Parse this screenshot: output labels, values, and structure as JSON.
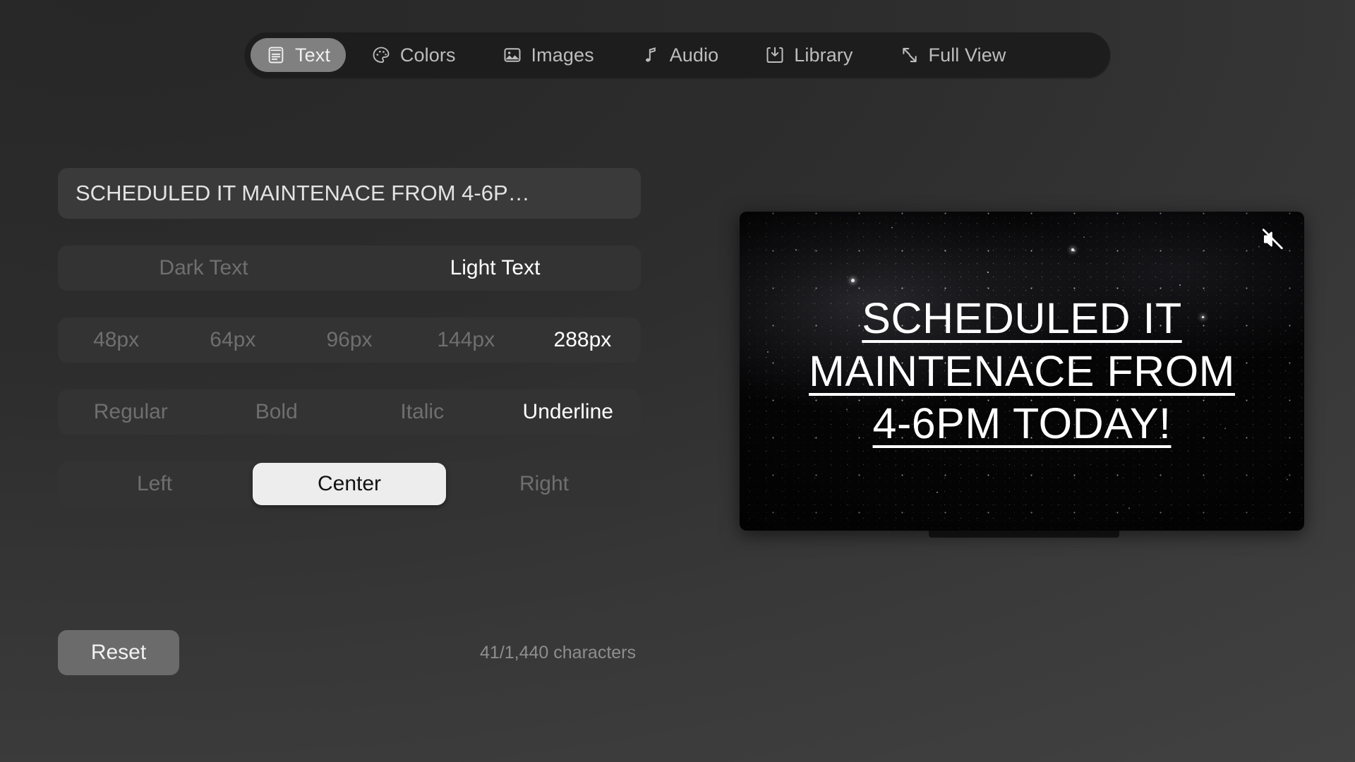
{
  "nav": {
    "items": [
      {
        "label": "Text",
        "icon": "text-document-icon",
        "active": true
      },
      {
        "label": "Colors",
        "icon": "palette-icon",
        "active": false
      },
      {
        "label": "Images",
        "icon": "image-icon",
        "active": false
      },
      {
        "label": "Audio",
        "icon": "music-note-icon",
        "active": false
      },
      {
        "label": "Library",
        "icon": "download-tray-icon",
        "active": false
      },
      {
        "label": "Full View",
        "icon": "expand-arrows-icon",
        "active": false
      }
    ]
  },
  "editor": {
    "text_input": {
      "value": "SCHEDULED IT MAINTENACE FROM 4-6P…",
      "placeholder": "Enter your message"
    },
    "rows": {
      "theme": {
        "name": "text-theme",
        "options": [
          "Dark Text",
          "Light Text"
        ],
        "selected": "Light Text"
      },
      "size": {
        "name": "font-size",
        "options": [
          "48px",
          "64px",
          "96px",
          "144px",
          "288px"
        ],
        "selected": "288px"
      },
      "style": {
        "name": "font-style",
        "options": [
          "Regular",
          "Bold",
          "Italic",
          "Underline"
        ],
        "selected": "Underline"
      },
      "alignment": {
        "name": "text-alignment",
        "options": [
          "Left",
          "Center",
          "Right"
        ],
        "selected": "Center",
        "hovered": "Center"
      }
    },
    "reset_label": "Reset",
    "char_count": "41/1,440 characters"
  },
  "preview": {
    "mute_icon": "speaker-muted-icon",
    "lines": [
      "SCHEDULED IT",
      "MAINTENACE FROM",
      "4-6PM TODAY!"
    ]
  },
  "colors": {
    "background_top": "#272727",
    "background_bottom": "#424242",
    "nav_bar": "#1d1d1d",
    "nav_active": "#808080",
    "control_track": "#333333",
    "input_bg": "#3a3a3a",
    "hover_pill": "#ededed",
    "reset_bg": "#6b6b6b",
    "selected_text": "#ffffff",
    "muted_text": "#6f6f6f"
  }
}
